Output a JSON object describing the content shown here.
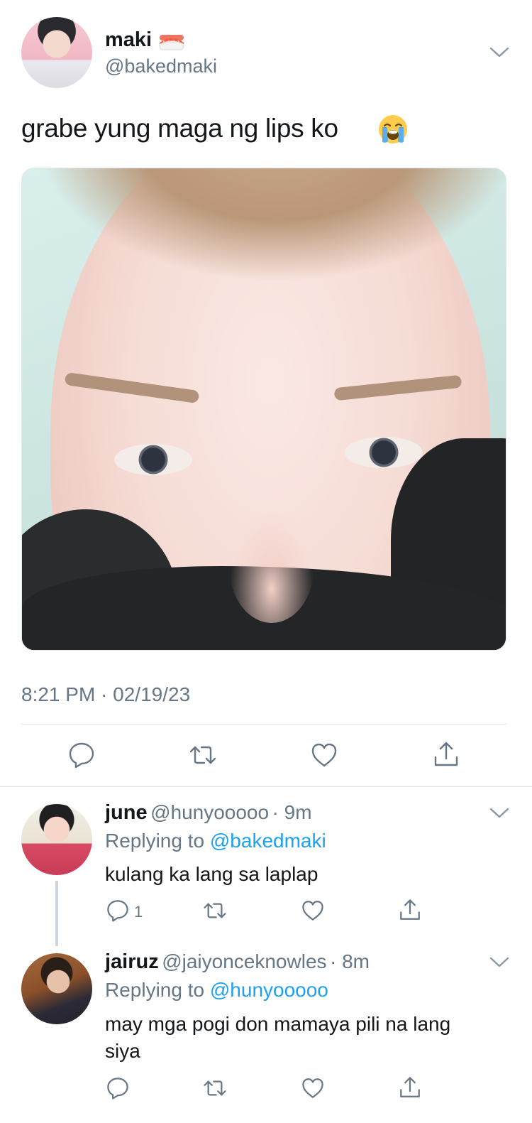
{
  "main_tweet": {
    "display_name": "maki",
    "handle": "@bakedmaki",
    "text": "grabe yung maga ng lips ko",
    "timestamp": "8:21 PM · 02/19/23",
    "name_emoji": "sushi-icon",
    "text_emoji": "loudly-crying-face-icon"
  },
  "replies": [
    {
      "display_name": "june",
      "handle": "@hunyooooo",
      "time": "· 9m",
      "replying_prefix": "Replying to",
      "replying_to": "@bakedmaki",
      "text": "kulang ka lang sa laplap",
      "reply_count": "1"
    },
    {
      "display_name": "jairuz",
      "handle": "@jaiyonceknowles",
      "time": "· 8m",
      "replying_prefix": "Replying to",
      "replying_to": "@hunyooooo",
      "text_line1": "may mga pogi don mamaya pili na lang",
      "text_line2": "siya"
    }
  ],
  "colors": {
    "text_primary": "#14171a",
    "text_secondary": "#657786",
    "link": "#1da1f2",
    "divider": "#e1e8ed"
  }
}
